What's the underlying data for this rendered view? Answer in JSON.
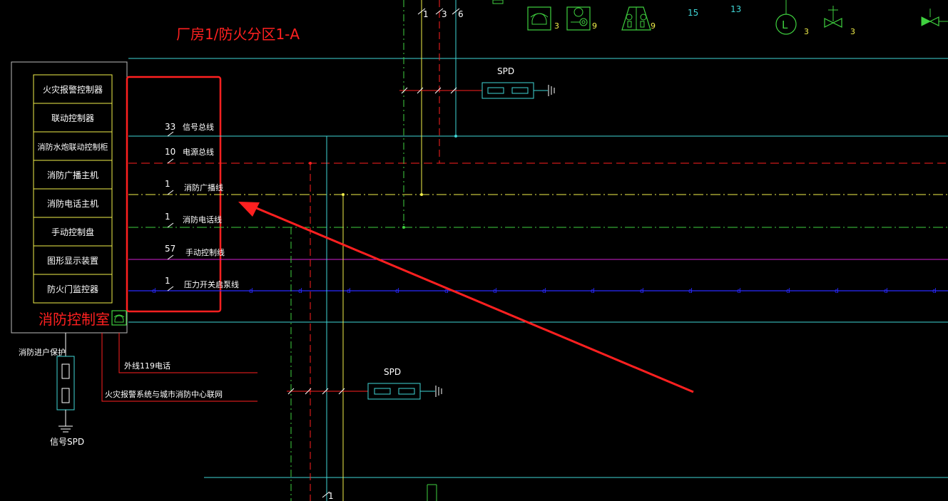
{
  "title": "厂房1/防火分区1-A",
  "control_room": {
    "label": "消防控制室",
    "devices": [
      "火灾报警控制器",
      "联动控制器",
      "消防水炮联动控制柜",
      "消防广播主机",
      "消防电话主机",
      "手动控制盘",
      "图形显示装置",
      "防火门监控器"
    ]
  },
  "buses": [
    {
      "count": "33",
      "label": "信号总线"
    },
    {
      "count": "10",
      "label": "电源总线"
    },
    {
      "count": "1",
      "label": "消防广播线"
    },
    {
      "count": "1",
      "label": "消防电话线"
    },
    {
      "count": "57",
      "label": "手动控制线"
    },
    {
      "count": "1",
      "label": "压力开关启泵线"
    }
  ],
  "external_links": {
    "phone_119": "外线119电话",
    "city_network": "火灾报警系统与城市消防中心联网",
    "entry_protection": "消防进户保护",
    "signal_spd": "信号SPD"
  },
  "spd_labels": [
    "SPD",
    "SPD"
  ],
  "top_numbers": {
    "riser_1": "1",
    "riser_3": "3",
    "riser_6": "6",
    "n15": "15",
    "n13": "13",
    "s1": "3",
    "s2": "9",
    "s3": "9",
    "s4": "3",
    "s5": "3",
    "bottom_1": "1"
  },
  "legend_letter": "L",
  "bus_marker": "d",
  "colors": {
    "red": "#ff2020",
    "cyan": "#3fd6d6",
    "yellow": "#f2ef4a",
    "green": "#3fd13f",
    "magenta": "#d21fd2",
    "blue": "#2a2aff",
    "white": "#ffffff"
  }
}
